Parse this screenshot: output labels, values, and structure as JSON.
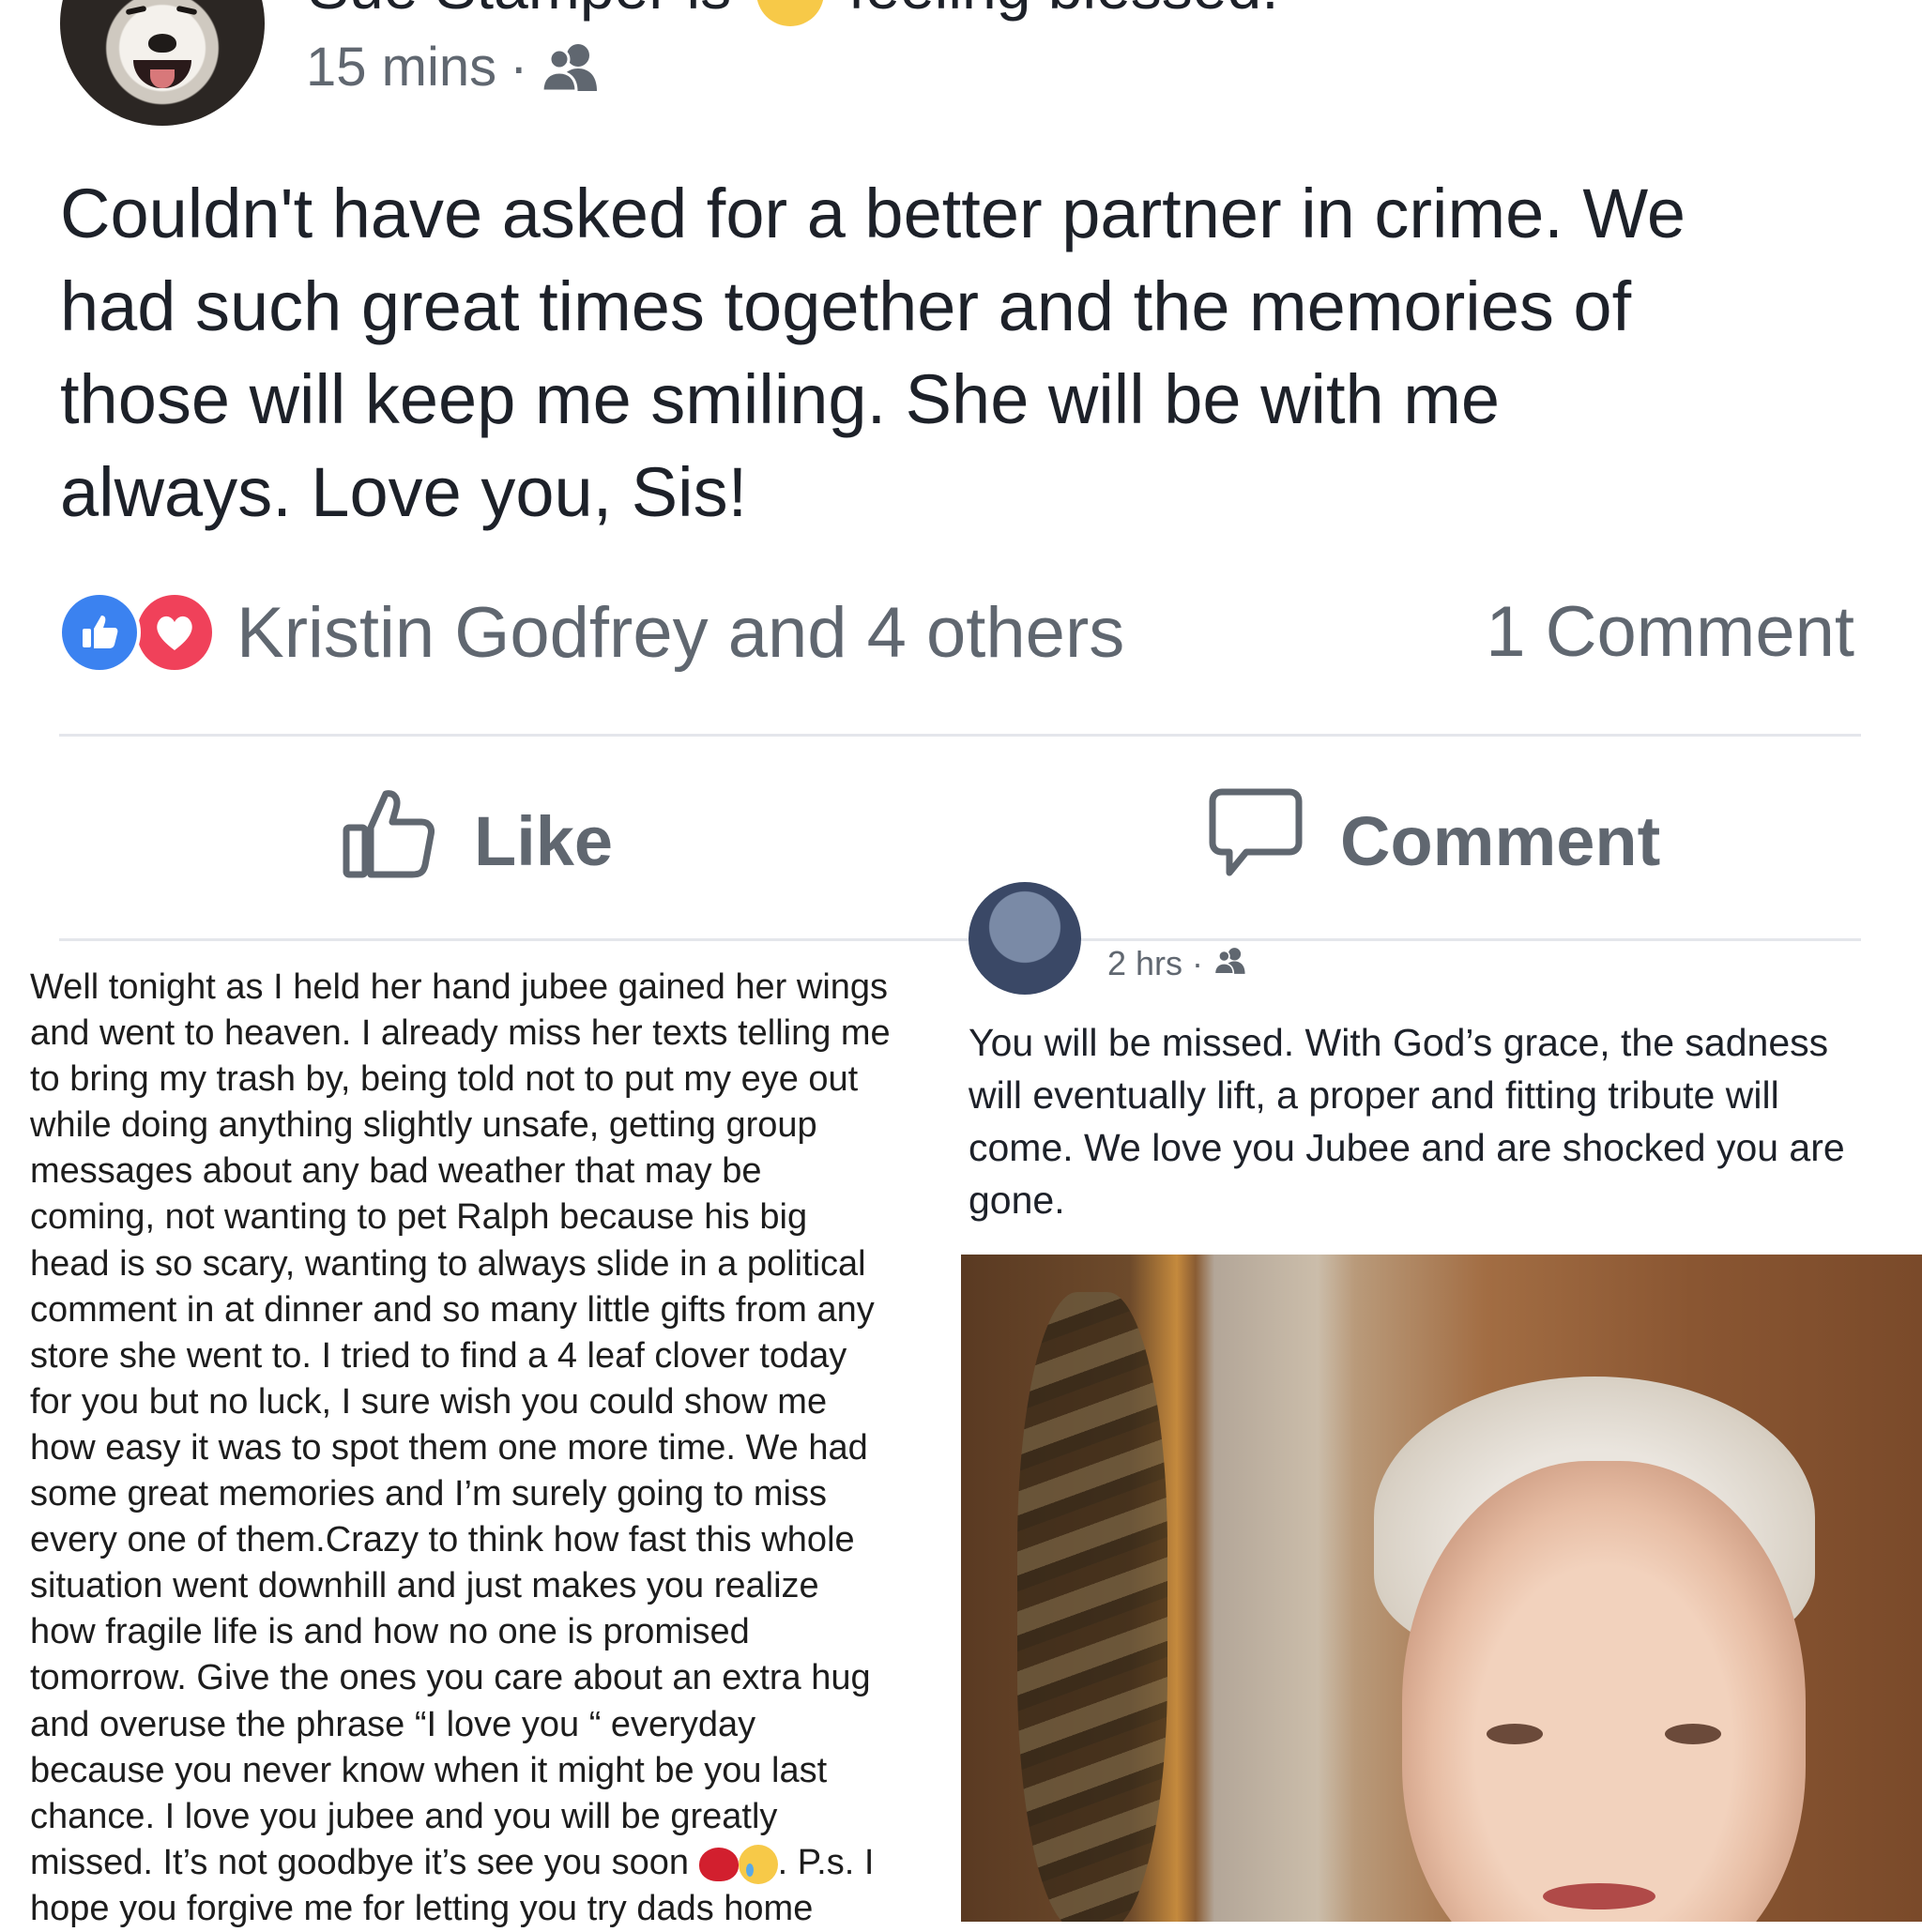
{
  "post": {
    "author_line_prefix": "Sue Stamper is",
    "author_line_suffix": "feeling blessed.",
    "time": "15 mins",
    "time_separator": "·",
    "audience_icon": "friends-icon",
    "text": "Couldn't have asked for a better partner in crime.  We\nhad such great times together and the memories of\nthose will keep me smiling.  She will be with me\nalways.  Love you, Sis!",
    "reactions": {
      "icons": [
        "like-icon",
        "love-icon"
      ],
      "label": "Kristin Godfrey and 4 others",
      "comment_count": "1 Comment"
    },
    "actions": {
      "like": "Like",
      "comment": "Comment"
    }
  },
  "tribute": {
    "text_main": "Well tonight as I held her hand jubee gained her wings\nand went to heaven. I already miss her texts telling me\nto bring my trash by, being told not to put my eye out\nwhile doing anything slightly unsafe, getting group\nmessages about any bad weather that may be\ncoming, not wanting to pet Ralph because his big\nhead is so scary, wanting to always slide in a political\ncomment in at dinner and so many little gifts from any\nstore she went to. I tried to find a 4 leaf clover today\nfor you but no luck, I sure wish you could show me\nhow easy it was to spot them one more time. We had\nsome great memories and I’m surely going to miss\nevery one of them.Crazy to think how fast this whole\nsituation went downhill and just makes you realize\nhow fragile life is and how no one is promised\ntomorrow. Give the ones you care about an extra hug\nand overuse the phrase “I love you “ everyday\nbecause you never know when it might be you last\nchance. I love you jubee and you will be greatly",
    "text_last_before_emoji": "missed. It’s not goodbye it’s see you soon ",
    "text_last_after_emoji": ". P.s. I",
    "text_cut": "hope you forgive me for letting you try dads home"
  },
  "comment": {
    "time": "2 hrs",
    "time_separator": "·",
    "text": "You will be missed.  With God’s grace, the sadness\nwill eventually lift, a  proper and fitting tribute will\ncome. We love you Jubee and are shocked you are\ngone."
  },
  "colors": {
    "like_blue": "#3b82f0",
    "love_red": "#f0415a",
    "secondary_text": "#606770",
    "divider": "#e4e6eb"
  }
}
